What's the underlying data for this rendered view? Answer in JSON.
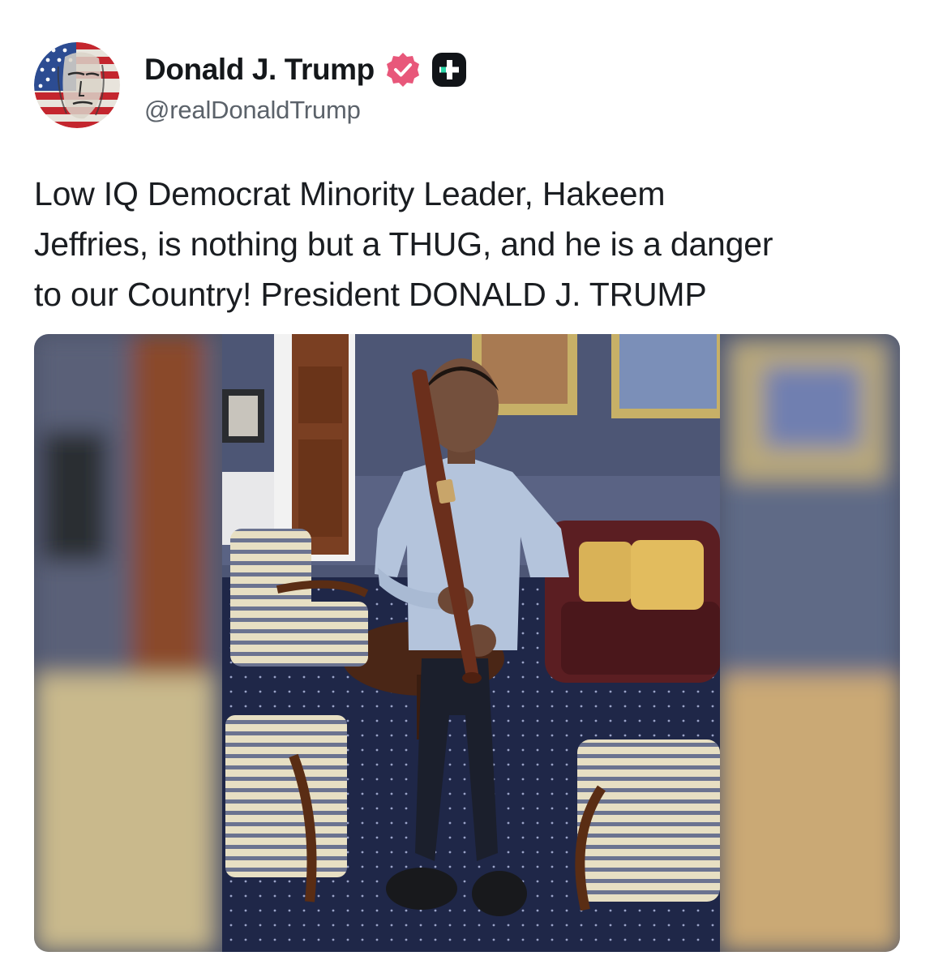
{
  "post": {
    "author": {
      "display_name": "Donald J. Trump",
      "handle": "@realDonaldTrump",
      "avatar": "flag-portrait-avatar",
      "verified_icon": "verified-badge-icon",
      "membership_icon": "plus-badge-icon"
    },
    "text": "Low IQ Democrat Minority Leader, Hakeem\nJeffries, is nothing but a THUG, and he is a danger\nto our Country! President DONALD J. TRUMP",
    "media": {
      "type": "photo",
      "description_icon": "photo-man-holding-baseball-bat"
    }
  },
  "colors": {
    "verified_badge": "#e8577a",
    "plus_badge": "#111418",
    "plus_accent": "#2bd5a8",
    "handle_text": "#5b626a"
  }
}
